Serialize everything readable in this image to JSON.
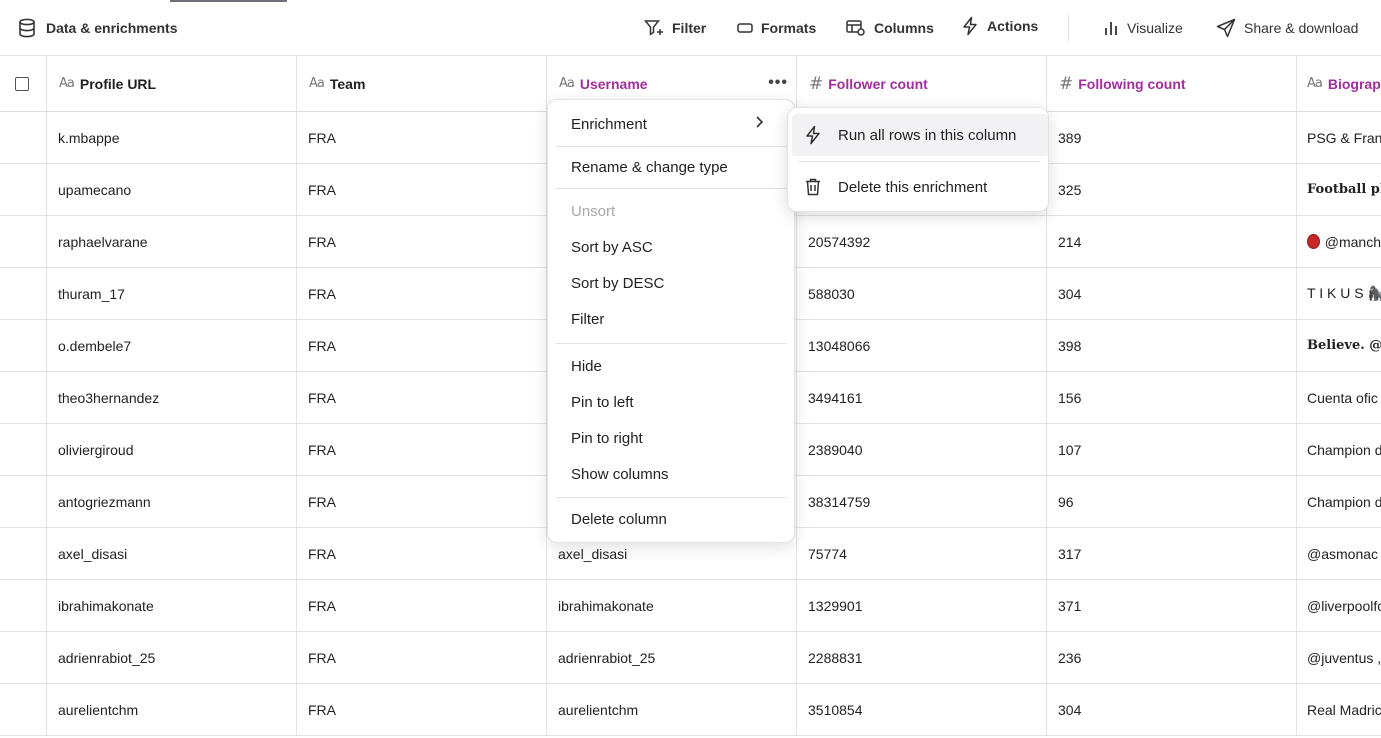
{
  "toolbar": {
    "title": "Data & enrichments",
    "filter": "Filter",
    "formats": "Formats",
    "columns": "Columns",
    "actions": "Actions",
    "visualize": "Visualize",
    "share": "Share & download"
  },
  "columns": [
    {
      "label": "Profile URL",
      "type": "text"
    },
    {
      "label": "Team",
      "type": "text"
    },
    {
      "label": "Username",
      "type": "text"
    },
    {
      "label": "Follower count",
      "type": "number"
    },
    {
      "label": "Following count",
      "type": "number"
    },
    {
      "label": "Biograp",
      "type": "text"
    }
  ],
  "type_icons": {
    "text": "Aa",
    "number": "#"
  },
  "rows": [
    {
      "profile": "k.mbappe",
      "team": "FRA",
      "username": "",
      "followers": "",
      "following": "389",
      "bio": "PSG & Franc"
    },
    {
      "profile": "upamecano",
      "team": "FRA",
      "username": "",
      "followers": "",
      "following": "325",
      "bio": "Football pla"
    },
    {
      "profile": "raphaelvarane",
      "team": "FRA",
      "username": "",
      "followers": "20574392",
      "following": "214",
      "bio": "@manch"
    },
    {
      "profile": "thuram_17",
      "team": "FRA",
      "username": "",
      "followers": "588030",
      "following": "304",
      "bio": "T I K U S 🦍"
    },
    {
      "profile": "o.dembele7",
      "team": "FRA",
      "username": "",
      "followers": "13048066",
      "following": "398",
      "bio": "Believe. @fc"
    },
    {
      "profile": "theo3hernandez",
      "team": "FRA",
      "username": "",
      "followers": "3494161",
      "following": "156",
      "bio": "Cuenta ofic"
    },
    {
      "profile": "oliviergiroud",
      "team": "FRA",
      "username": "",
      "followers": "2389040",
      "following": "107",
      "bio": "Champion d"
    },
    {
      "profile": "antogriezmann",
      "team": "FRA",
      "username": "",
      "followers": "38314759",
      "following": "96",
      "bio": "Champion d"
    },
    {
      "profile": "axel_disasi",
      "team": "FRA",
      "username": "axel_disasi",
      "followers": "75774",
      "following": "317",
      "bio": "@asmonac"
    },
    {
      "profile": "ibrahimakonate",
      "team": "FRA",
      "username": "ibrahimakonate",
      "followers": "1329901",
      "following": "371",
      "bio": "@liverpoolfc"
    },
    {
      "profile": "adrienrabiot_25",
      "team": "FRA",
      "username": "adrienrabiot_25",
      "followers": "2288831",
      "following": "236",
      "bio": "@juventus ,"
    },
    {
      "profile": "aurelientchm",
      "team": "FRA",
      "username": "aurelientchm",
      "followers": "3510854",
      "following": "304",
      "bio": "Real Madric"
    }
  ],
  "column_menu": {
    "enrichment": "Enrichment",
    "rename": "Rename & change type",
    "unsort": "Unsort",
    "sort_asc": "Sort by ASC",
    "sort_desc": "Sort by DESC",
    "filter": "Filter",
    "hide": "Hide",
    "pin_left": "Pin to left",
    "pin_right": "Pin to right",
    "show_columns": "Show columns",
    "delete_column": "Delete column"
  },
  "enrichment_submenu": {
    "run_all": "Run all rows in this column",
    "delete": "Delete this enrichment"
  },
  "colors": {
    "accent_purple": "#a02e9b",
    "border": "#e3e3e6"
  }
}
